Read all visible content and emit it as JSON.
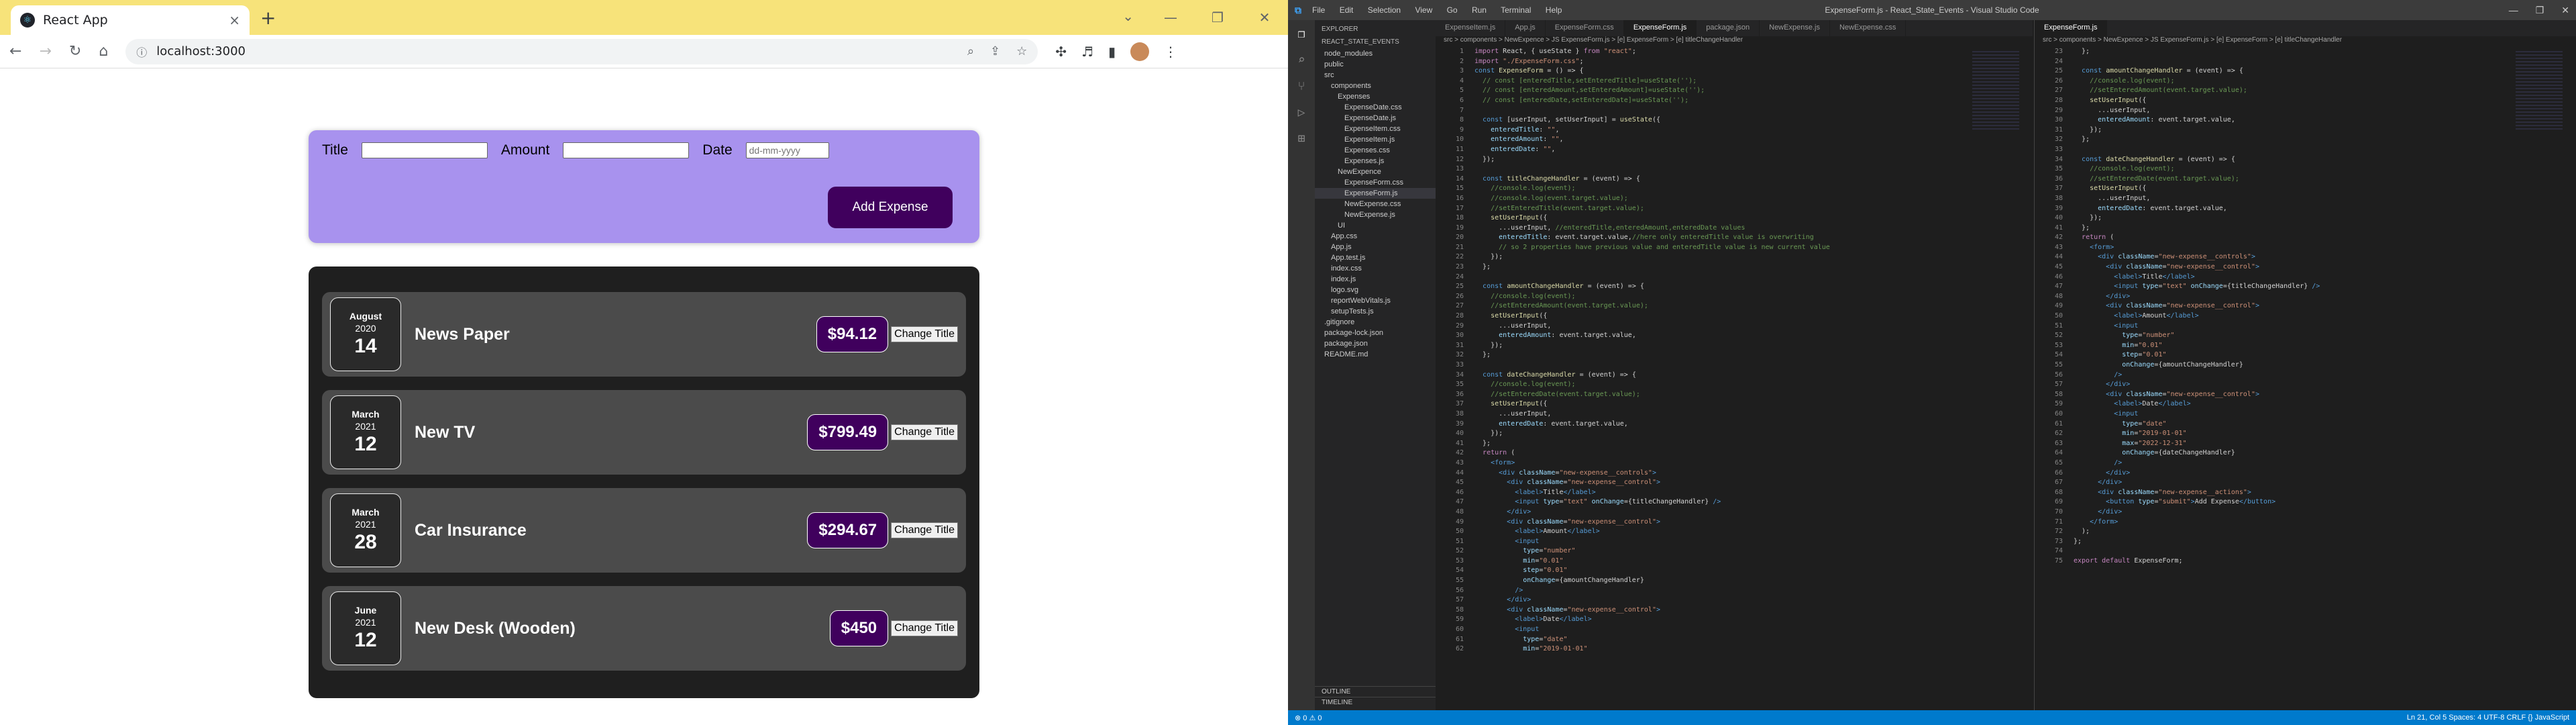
{
  "browser": {
    "tab_title": "React App",
    "url": "localhost:3000"
  },
  "form": {
    "title_label": "Title",
    "amount_label": "Amount",
    "date_label": "Date",
    "date_placeholder": "dd-mm-yyyy",
    "submit_label": "Add Expense"
  },
  "expenses": [
    {
      "month": "August",
      "year": "2020",
      "day": "14",
      "title": "News Paper",
      "amount": "$94.12",
      "button": "Change Title"
    },
    {
      "month": "March",
      "year": "2021",
      "day": "12",
      "title": "New TV",
      "amount": "$799.49",
      "button": "Change Title"
    },
    {
      "month": "March",
      "year": "2021",
      "day": "28",
      "title": "Car Insurance",
      "amount": "$294.67",
      "button": "Change Title"
    },
    {
      "month": "June",
      "year": "2021",
      "day": "12",
      "title": "New Desk (Wooden)",
      "amount": "$450",
      "button": "Change Title"
    }
  ],
  "vscode": {
    "window_title": "ExpenseForm.js - React_State_Events - Visual Studio Code",
    "menu": [
      "File",
      "Edit",
      "Selection",
      "View",
      "Go",
      "Run",
      "Terminal",
      "Help"
    ],
    "explorer_title": "EXPLORER",
    "project": "REACT_STATE_EVENTS",
    "files": [
      "node_modules",
      "public",
      "src",
      "components",
      "Expenses",
      "ExpenseDate.css",
      "ExpenseDate.js",
      "ExpenseItem.css",
      "ExpenseItem.js",
      "Expenses.css",
      "Expenses.js",
      "NewExpence",
      "ExpenseForm.css",
      "ExpenseForm.js",
      "NewExpense.css",
      "NewExpense.js",
      "UI",
      "App.css",
      "App.js",
      "App.test.js",
      "index.css",
      "index.js",
      "logo.svg",
      "reportWebVitals.js",
      "setupTests.js",
      ".gitignore",
      "package-lock.json",
      "package.json",
      "README.md"
    ],
    "outline": "OUTLINE",
    "timeline": "TIMELINE",
    "left_tabs": [
      "ExpenseItem.js",
      "App.js",
      "ExpenseForm.css",
      "ExpenseForm.js",
      "package.json",
      "NewExpense.js",
      "NewExpense.css"
    ],
    "right_tabs": [
      "ExpenseForm.js"
    ],
    "breadcrumb": "src > components > NewExpence > JS ExpenseForm.js > [e] ExpenseForm > [e] titleChangeHandler",
    "status_right": "Ln 21, Col 5   Spaces: 4   UTF-8   CRLF   {} JavaScript"
  }
}
